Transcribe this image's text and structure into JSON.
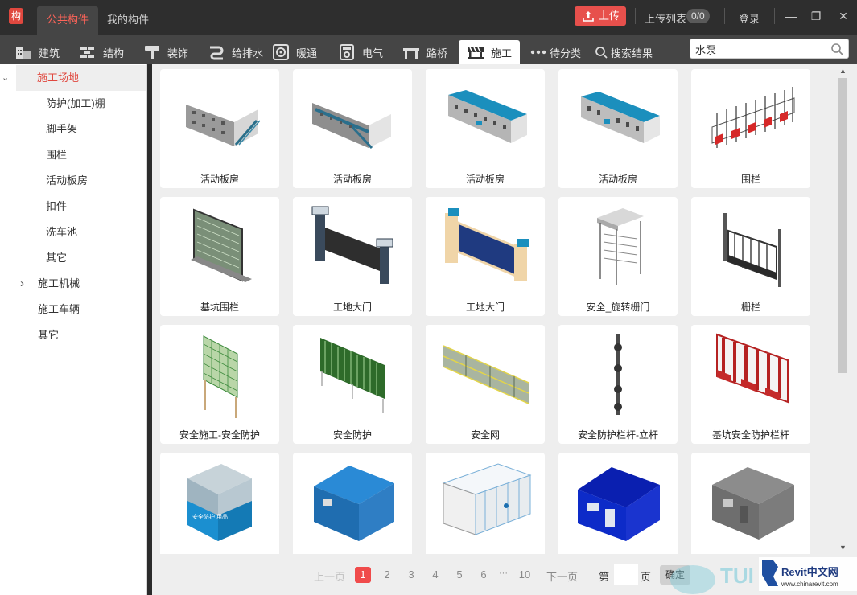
{
  "titlebar": {
    "logo_char": "构",
    "tabs": [
      {
        "label": "公共构件",
        "active": true
      },
      {
        "label": "我的构件",
        "active": false
      }
    ],
    "upload_label": "上传",
    "upload_list_label": "上传列表",
    "upload_count": "0/0",
    "login_label": "登录",
    "min_icon": "—",
    "max_icon": "❐",
    "close_icon": "✕"
  },
  "categories": [
    {
      "label": "建筑",
      "icon": "building-icon",
      "active": false
    },
    {
      "label": "结构",
      "icon": "bricks-icon",
      "active": false
    },
    {
      "label": "装饰",
      "icon": "paint-roller-icon",
      "active": false
    },
    {
      "label": "给排水",
      "icon": "pipe-icon",
      "active": false
    },
    {
      "label": "暖通",
      "icon": "fan-icon",
      "active": false
    },
    {
      "label": "电气",
      "icon": "electrical-box-icon",
      "active": false
    },
    {
      "label": "路桥",
      "icon": "bridge-icon",
      "active": false
    },
    {
      "label": "施工",
      "icon": "barrier-icon",
      "active": true
    },
    {
      "label": "待分类",
      "icon": "more-dots-icon",
      "active": false
    },
    {
      "label": "搜索结果",
      "icon": "search-icon",
      "active": false
    }
  ],
  "search": {
    "value": "水泵"
  },
  "sidebar": {
    "items": [
      {
        "label": "施工场地",
        "chev": "⌄",
        "level": 0,
        "active": true
      },
      {
        "label": "防护(加工)棚",
        "level": 1
      },
      {
        "label": "脚手架",
        "level": 1
      },
      {
        "label": "围栏",
        "level": 1
      },
      {
        "label": "活动板房",
        "level": 1
      },
      {
        "label": "扣件",
        "level": 1
      },
      {
        "label": "洗车池",
        "level": 1
      },
      {
        "label": "其它",
        "level": 1
      },
      {
        "label": "施工机械",
        "chev": "›",
        "level": 0
      },
      {
        "label": "施工车辆",
        "level": 0
      },
      {
        "label": "其它",
        "level": 0
      }
    ]
  },
  "grid": {
    "items": [
      {
        "label": "活动板房",
        "icon": "prefab-house-stairs-icon"
      },
      {
        "label": "活动板房",
        "icon": "prefab-house-stairs-icon"
      },
      {
        "label": "活动板房",
        "icon": "prefab-house-blue-roof-icon"
      },
      {
        "label": "活动板房",
        "icon": "prefab-house-blue-roof-icon"
      },
      {
        "label": "围栏",
        "icon": "red-white-fence-icon"
      },
      {
        "label": "基坑围栏",
        "icon": "pit-fence-panel-icon"
      },
      {
        "label": "工地大门",
        "icon": "site-gate-dark-icon"
      },
      {
        "label": "工地大门",
        "icon": "site-gate-blue-icon"
      },
      {
        "label": "安全_旋转栅门",
        "icon": "turnstile-gate-icon"
      },
      {
        "label": "栅栏",
        "icon": "iron-gate-icon"
      },
      {
        "label": "安全施工-安全防护",
        "icon": "green-mesh-icon"
      },
      {
        "label": "安全防护",
        "icon": "green-fence-icon"
      },
      {
        "label": "安全网",
        "icon": "safety-net-icon"
      },
      {
        "label": "安全防护栏杆-立杆",
        "icon": "railing-post-icon"
      },
      {
        "label": "基坑安全防护栏杆",
        "icon": "red-railing-icon"
      },
      {
        "label": "",
        "icon": "glass-booth-icon"
      },
      {
        "label": "",
        "icon": "blue-container-icon"
      },
      {
        "label": "",
        "icon": "white-cabins-icon"
      },
      {
        "label": "",
        "icon": "navy-container-icon"
      },
      {
        "label": "",
        "icon": "grey-container-icon"
      }
    ],
    "booth_text": "安全防护 用品"
  },
  "pager": {
    "prev": "上一页",
    "pages": [
      "1",
      "2",
      "3",
      "4",
      "5",
      "6"
    ],
    "ellipsis": "···",
    "last": "10",
    "next": "下一页",
    "goto_prefix": "第",
    "goto_suffix": "页",
    "confirm": "确定",
    "current": 1
  },
  "watermark": {
    "text": "TUI",
    "brand": "Revit中文网",
    "url": "www.chinarevit.com"
  },
  "colors": {
    "accent": "#e0483f",
    "active_page": "#f04b4b"
  }
}
